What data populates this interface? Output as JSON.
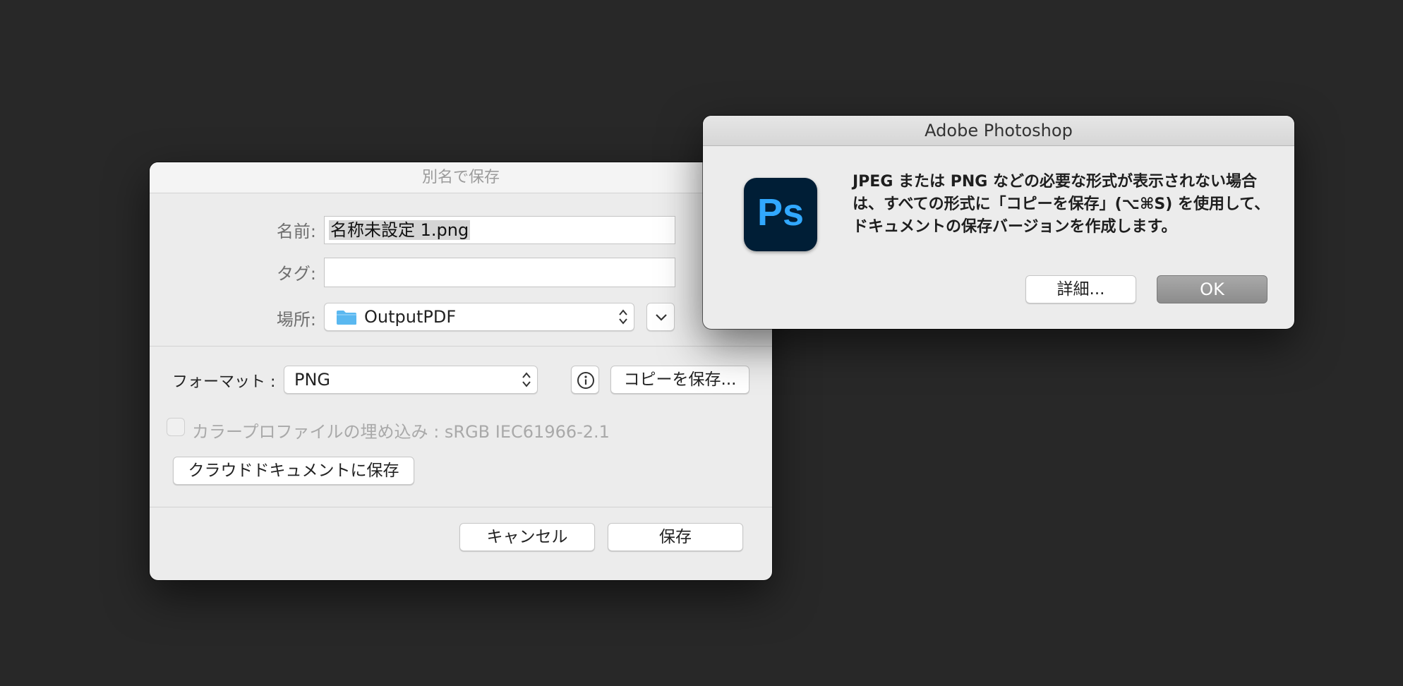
{
  "save_dialog": {
    "title": "別名で保存",
    "name_label": "名前:",
    "name_value": "名称未設定 1.png",
    "tags_label": "タグ:",
    "tags_value": "",
    "where_label": "場所:",
    "where_value": "OutputPDF",
    "format_label": "フォーマット :",
    "format_value": "PNG",
    "save_copy_label": "コピーを保存...",
    "embed_profile_label": "カラープロファイルの埋め込み : sRGB IEC61966-2.1",
    "embed_profile_checked": false,
    "cloud_save_label": "クラウドドキュメントに保存",
    "cancel_label": "キャンセル",
    "save_label": "保存"
  },
  "alert": {
    "title": "Adobe Photoshop",
    "icon_text": "Ps",
    "message": "JPEG または PNG などの必要な形式が表示されない場合は、すべての形式に「コピーを保存」(⌥⌘S) を使用して、ドキュメントの保存バージョンを作成します。",
    "details_label": "詳細...",
    "ok_label": "OK"
  },
  "colors": {
    "background": "#282828",
    "ps_icon_bg": "#001e36",
    "ps_icon_fg": "#31a8ff",
    "folder": "#5ab8f0"
  }
}
